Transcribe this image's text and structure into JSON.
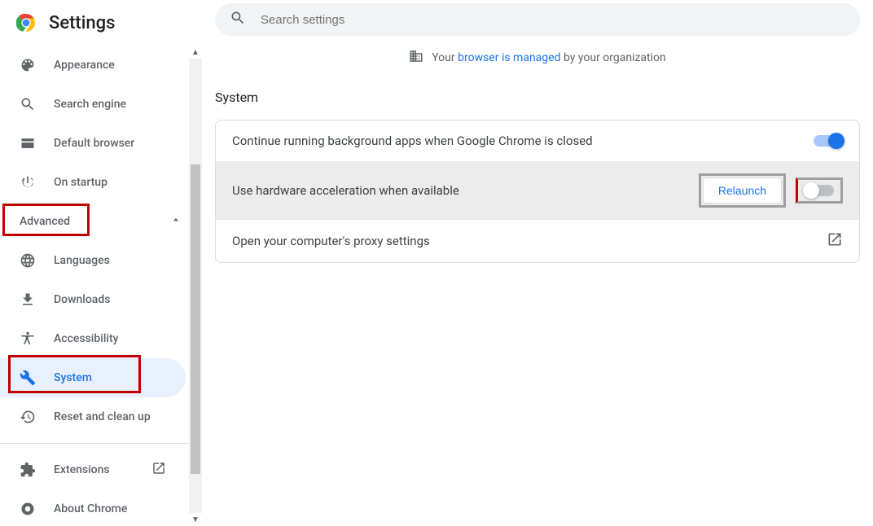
{
  "header": {
    "title": "Settings"
  },
  "search": {
    "placeholder": "Search settings"
  },
  "managed": {
    "prefix": "Your ",
    "link": "browser is managed",
    "suffix": " by your organization"
  },
  "sidebar": {
    "items": [
      {
        "icon": "palette",
        "label": "Appearance"
      },
      {
        "icon": "search",
        "label": "Search engine"
      },
      {
        "icon": "browser",
        "label": "Default browser"
      },
      {
        "icon": "power",
        "label": "On startup"
      }
    ],
    "advanced_label": "Advanced",
    "advanced_items": [
      {
        "icon": "globe",
        "label": "Languages"
      },
      {
        "icon": "download",
        "label": "Downloads"
      },
      {
        "icon": "accessibility",
        "label": "Accessibility"
      },
      {
        "icon": "wrench",
        "label": "System",
        "active": true
      },
      {
        "icon": "restore",
        "label": "Reset and clean up"
      }
    ],
    "footer": [
      {
        "icon": "extension",
        "label": "Extensions",
        "trailing": "open"
      },
      {
        "icon": "chrome",
        "label": "About Chrome"
      }
    ]
  },
  "section": {
    "title": "System"
  },
  "rows": {
    "bg_apps": {
      "label": "Continue running background apps when Google Chrome is closed",
      "toggle": true
    },
    "hw_accel": {
      "label": "Use hardware acceleration when available",
      "relaunch_label": "Relaunch",
      "toggle": false
    },
    "proxy": {
      "label": "Open your computer's proxy settings"
    }
  },
  "colors": {
    "accent": "#1a73e8",
    "highlight": "#c00000"
  }
}
